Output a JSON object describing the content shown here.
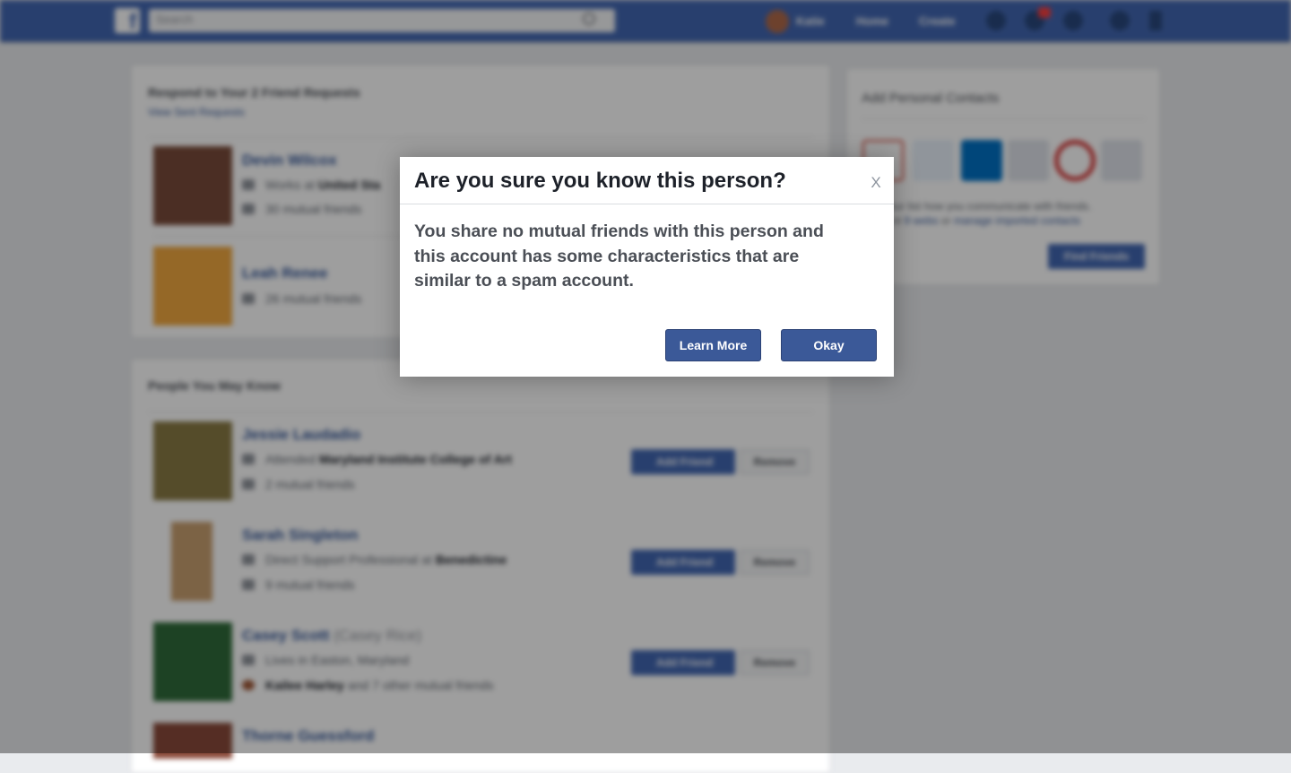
{
  "topbar": {
    "logo_glyph": "f",
    "search_placeholder": "Search",
    "profile_name": "Katie",
    "home_label": "Home",
    "create_label": "Create",
    "brand_color": "#4267b2"
  },
  "requests": {
    "title": "Respond to Your 2 Friend Requests",
    "sent_link": "View Sent Requests",
    "items": [
      {
        "name": "Devin Wilcox",
        "line1": "Works at ",
        "line1_bold": "United Sta",
        "line2": "30 mutual friends"
      },
      {
        "name": "Leah Renee",
        "line1": "26 mutual friends"
      }
    ]
  },
  "pymk": {
    "title": "People You May Know",
    "add_label": "Add Friend",
    "remove_label": "Remove",
    "items": [
      {
        "name": "Jessie Laudadio",
        "line1": "Attended ",
        "line1_bold": "Maryland Institute College of Art",
        "line2": "2 mutual friends"
      },
      {
        "name": "Sarah Singleton",
        "line1": "Direct Support Professional at ",
        "line1_bold": "Benedictine",
        "line2": "9 mutual friends"
      },
      {
        "name": "Casey Scott",
        "alt_name": "(Casey Rice)",
        "line1": "Lives in Easton, Maryland",
        "line2_bold": "Kailee Harley",
        "line2": " and 7 other mutual friends"
      },
      {
        "name": "Thorne Guessford"
      }
    ]
  },
  "contacts": {
    "title": "Add Personal Contacts",
    "line1": "Your list how you communicate with friends.",
    "line2_pre": "...nt ",
    "line2_link1": "9 webs",
    "line2_mid": " or ",
    "line2_link2": "manage imported contacts",
    "find_label": "Find Friends"
  },
  "dialog": {
    "title": "Are you sure you know this person?",
    "close_label": "X",
    "body": "You share no mutual friends with this person and this account has some characteristics that are similar to a spam account.",
    "learn_more_label": "Learn More",
    "okay_label": "Okay",
    "button_color": "#3b5998"
  }
}
